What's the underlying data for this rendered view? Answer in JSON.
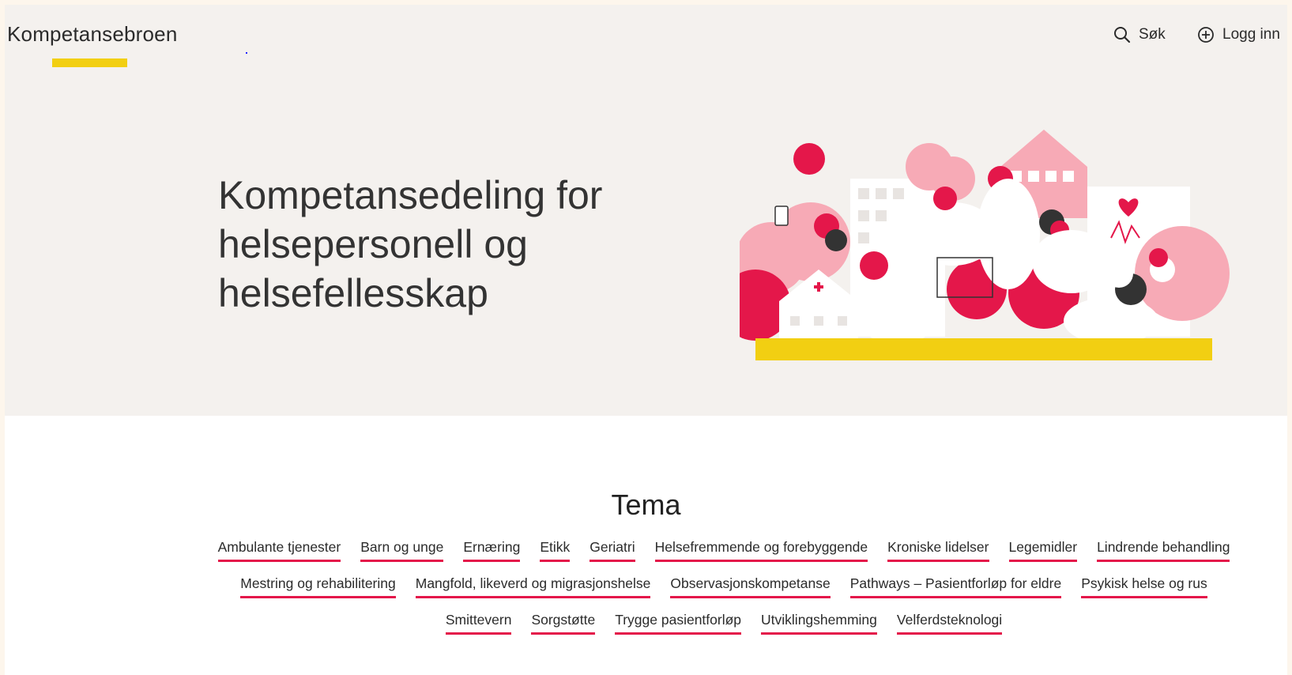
{
  "header": {
    "logo_text": "Kompetansebroen",
    "search_label": "Søk",
    "login_label": "Logg inn"
  },
  "hero": {
    "title": "Kompetansedeling for helsepersonell og helsefellesskap"
  },
  "tema": {
    "title": "Tema",
    "tags": [
      "Ambulante tjenester",
      "Barn og unge",
      "Ernæring",
      "Etikk",
      "Geriatri",
      "Helsefremmende og forebyggende",
      "Kroniske lidelser",
      "Legemidler",
      "Lindrende behandling",
      "Mestring og rehabilitering",
      "Mangfold, likeverd og migrasjonshelse",
      "Observasjonskompetanse",
      "Pathways – Pasientforløp for eldre",
      "Psykisk helse og rus",
      "Smittevern",
      "Sorgstøtte",
      "Trygge pasientforløp",
      "Utviklingshemming",
      "Velferdsteknologi"
    ]
  },
  "colors": {
    "accent_yellow": "#f2cf12",
    "accent_red": "#e4174a",
    "pink": "#f7aab6",
    "hero_background": "#f4f1ee"
  },
  "icons": [
    "search-icon",
    "plus-circle-icon"
  ]
}
